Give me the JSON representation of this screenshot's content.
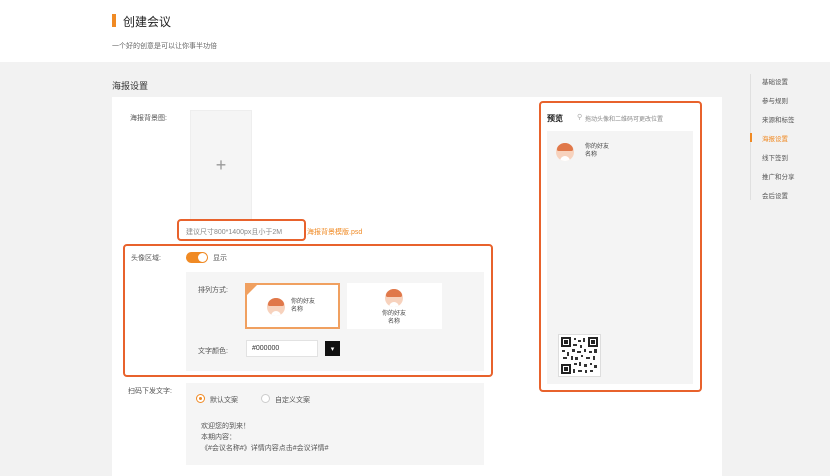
{
  "header": {
    "title": "创建会议",
    "subtitle": "一个好的创意是可以让你事半功倍"
  },
  "section": {
    "title": "海报设置"
  },
  "poster_bg": {
    "label": "海报背景图:",
    "plus": "+",
    "hint": "建议尺寸800*1400px且小于2M",
    "template_link": "海报背景模版.psd"
  },
  "avatar_area": {
    "label": "头像区域:",
    "toggle_label": "显示",
    "toggle_on": true,
    "layout_label": "排列方式:",
    "options": [
      {
        "name_line1": "你的好友",
        "name_line2": "名称",
        "selected": true
      },
      {
        "name_line1": "你的好友",
        "name_line2": "名称",
        "selected": false
      }
    ],
    "text_color_label": "文字颜色:",
    "text_color_value": "#000000",
    "swatch_icon": "▾"
  },
  "scan_text": {
    "label": "扫码下发文字:",
    "options": [
      "默认文案",
      "自定义文案"
    ],
    "selected_index": 0,
    "lines": [
      "欢迎您的到来！",
      "本期内容：",
      "《#会议名称#》详情内容点击#会议详情#"
    ]
  },
  "preview": {
    "title": "预览",
    "hint": "拖动头像和二维码可更改位置",
    "name_line1": "你的好友",
    "name_line2": "名称"
  },
  "nav": {
    "items": [
      "基础设置",
      "参与规则",
      "来源和标签",
      "海报设置",
      "线下签到",
      "推广和分享",
      "会后设置"
    ],
    "active_index": 3
  },
  "colors": {
    "accent": "#f08a24",
    "highlight": "#e8622c"
  }
}
